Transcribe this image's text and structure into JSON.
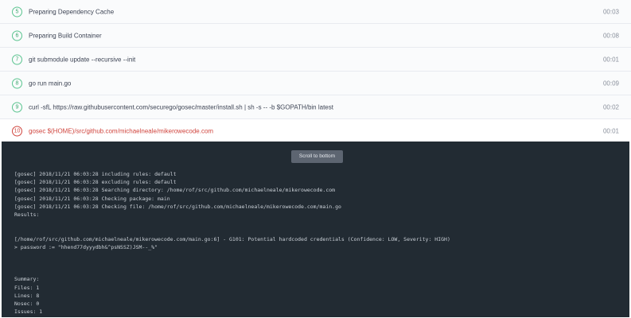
{
  "steps": [
    {
      "num": "5",
      "label": "Preparing Dependency Cache",
      "time": "00:03",
      "status": "success"
    },
    {
      "num": "6",
      "label": "Preparing Build Container",
      "time": "00:08",
      "status": "success"
    },
    {
      "num": "7",
      "label": "git submodule update --recursive --init",
      "time": "00:01",
      "status": "success"
    },
    {
      "num": "8",
      "label": "go run main.go",
      "time": "00:09",
      "status": "success"
    },
    {
      "num": "9",
      "label": "curl -sfL https://raw.githubusercontent.com/securego/gosec/master/install.sh | sh -s -- -b $GOPATH/bin latest",
      "time": "00:02",
      "status": "success"
    },
    {
      "num": "10",
      "label": "gosec $(HOME)/src/github.com/michaelneale/mikerowecode.com",
      "time": "00:01",
      "status": "error"
    }
  ],
  "console": {
    "scroll_button": "Scroll to bottom",
    "lines": [
      "[gosec] 2018/11/21 06:03:28 including rules: default",
      "[gosec] 2018/11/21 06:03:28 excluding rules: default",
      "[gosec] 2018/11/21 06:03:28 Searching directory: /home/rof/src/github.com/michaelneale/mikerowecode.com",
      "[gosec] 2018/11/21 06:03:28 Checking package: main",
      "[gosec] 2018/11/21 06:03:28 Checking file: /home/rof/src/github.com/michaelneale/mikerowecode.com/main.go",
      "Results:",
      "",
      "",
      "[/home/rof/src/github.com/michaelneale/mikerowecode.com/main.go:6] - G101: Potential hardcoded credentials (Confidence: LOW, Severity: HIGH)",
      "> password := \"hhend77dyyydbh&^psNSSZ)JSM--_%\"",
      "",
      "",
      "",
      "Summary:",
      "Files: 1",
      "Lines: 8",
      "Nosec: 0",
      "Issues: 1"
    ]
  }
}
